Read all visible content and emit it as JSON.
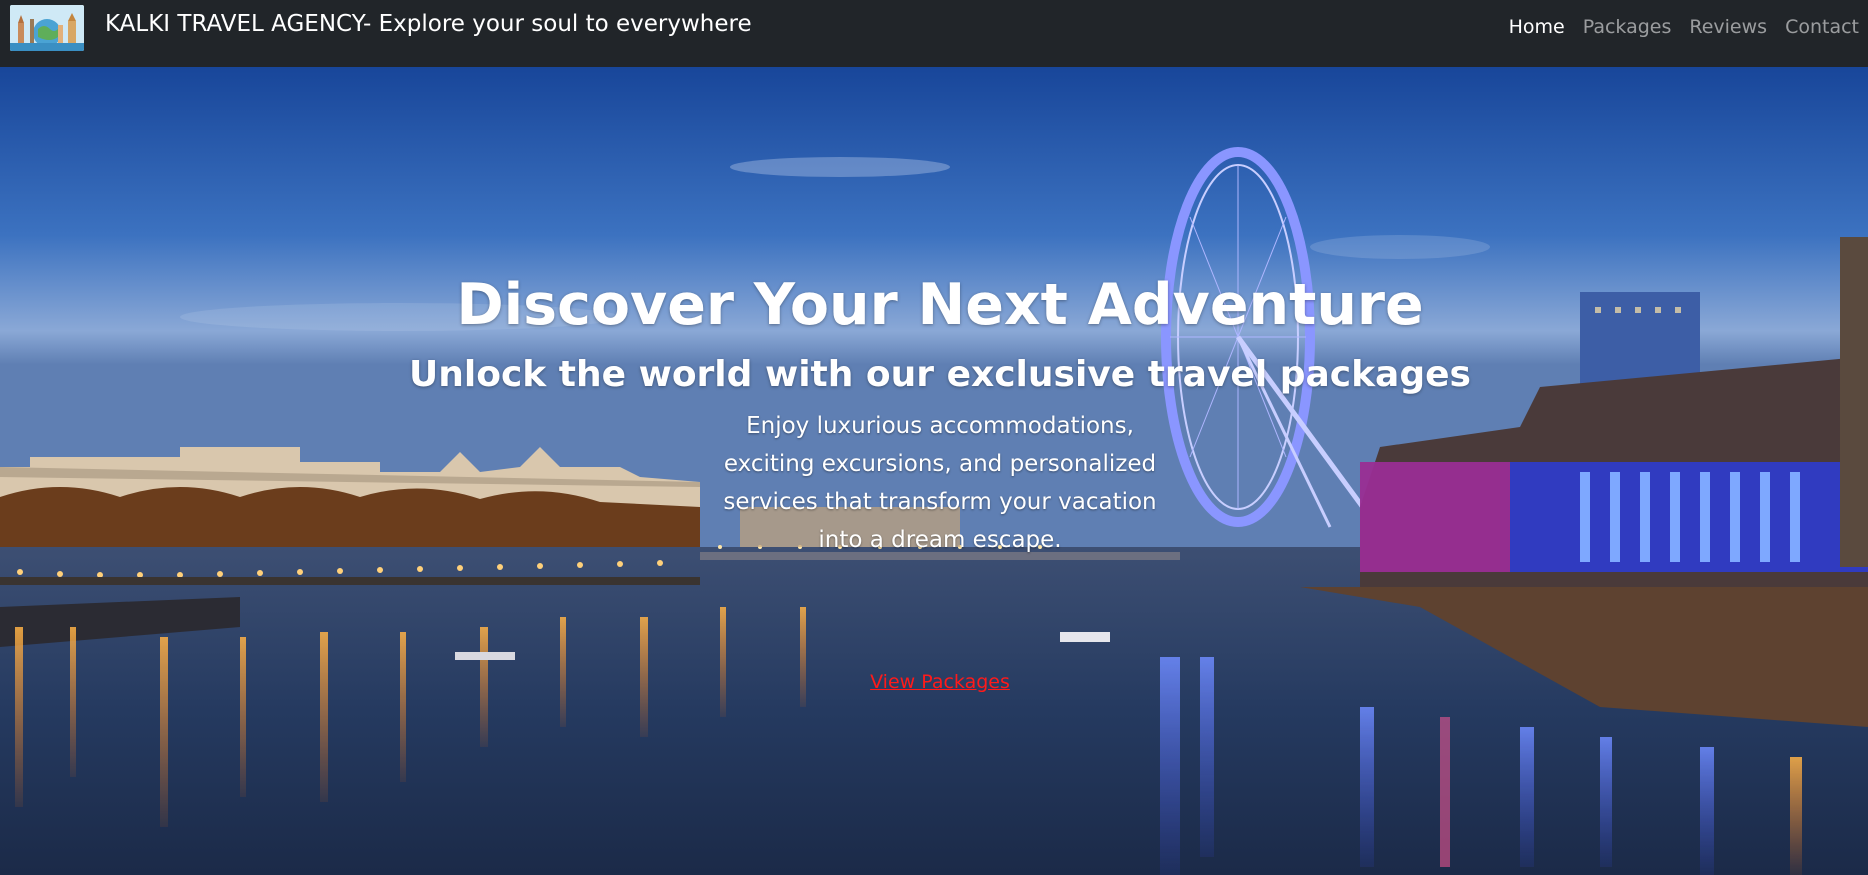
{
  "navbar": {
    "logo_icon": "world-landmarks-logo",
    "brand_title": "KALKI TRAVEL AGENCY- Explore your soul to everywhere",
    "links": [
      {
        "label": "Home",
        "active": true
      },
      {
        "label": "Packages",
        "active": false
      },
      {
        "label": "Reviews",
        "active": false
      },
      {
        "label": "Contact",
        "active": false
      }
    ],
    "background_color": "#212529"
  },
  "hero": {
    "background_scene": "london-eye-night-river",
    "title": "Discover Your Next Adventure",
    "subtitle": "Unlock the world with our exclusive travel packages",
    "description": "Enjoy luxurious accommodations, exciting excursions, and personalized services that transform your vacation into a dream escape.",
    "cta_label": "View Packages",
    "cta_color": "#ff1a1a"
  }
}
